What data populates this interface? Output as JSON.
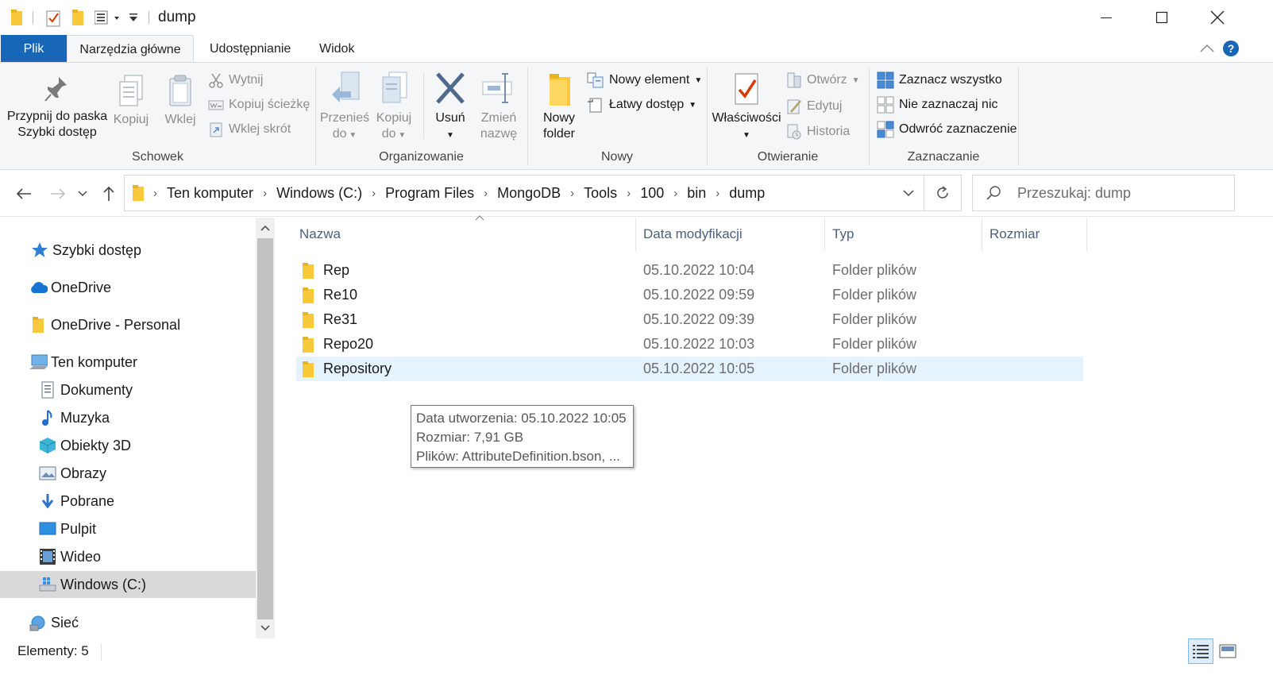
{
  "window": {
    "title": "dump"
  },
  "ribbon_tabs": [
    "Plik",
    "Narzędzia główne",
    "Udostępnianie",
    "Widok"
  ],
  "ribbon": {
    "clipboard": {
      "pin": "Przypnij do paska Szybki dostęp",
      "copy": "Kopiuj",
      "paste": "Wklej",
      "cut": "Wytnij",
      "copy_path": "Kopiuj ścieżkę",
      "paste_shortcut": "Wklej skrót",
      "label": "Schowek"
    },
    "organize": {
      "move_to": "Przenieś do",
      "copy_to": "Kopiuj do",
      "delete": "Usuń",
      "rename": "Zmień nazwę",
      "label": "Organizowanie"
    },
    "new": {
      "new_folder": "Nowy folder",
      "new_item": "Nowy element",
      "easy_access": "Łatwy dostęp",
      "label": "Nowy"
    },
    "open": {
      "properties": "Właściwości",
      "open": "Otwórz",
      "edit": "Edytuj",
      "history": "Historia",
      "label": "Otwieranie"
    },
    "select": {
      "select_all": "Zaznacz wszystko",
      "select_none": "Nie zaznaczaj nic",
      "invert": "Odwróć zaznaczenie",
      "label": "Zaznaczanie"
    }
  },
  "address": {
    "breadcrumbs": [
      "Ten komputer",
      "Windows (C:)",
      "Program Files",
      "MongoDB",
      "Tools",
      "100",
      "bin",
      "dump"
    ],
    "search_placeholder": "Przeszukaj: dump"
  },
  "nav_pane": [
    {
      "label": "Szybki dostęp",
      "icon": "star-icon"
    },
    {
      "label": "OneDrive",
      "icon": "cloud-icon"
    },
    {
      "label": "OneDrive - Personal",
      "icon": "folder-icon"
    },
    {
      "label": "Ten komputer",
      "icon": "computer-icon"
    },
    {
      "label": "Dokumenty",
      "icon": "document-icon"
    },
    {
      "label": "Muzyka",
      "icon": "music-icon"
    },
    {
      "label": "Obiekty 3D",
      "icon": "cube-icon"
    },
    {
      "label": "Obrazy",
      "icon": "picture-icon"
    },
    {
      "label": "Pobrane",
      "icon": "download-icon"
    },
    {
      "label": "Pulpit",
      "icon": "desktop-icon"
    },
    {
      "label": "Wideo",
      "icon": "video-icon"
    },
    {
      "label": "Windows (C:)",
      "icon": "drive-icon"
    },
    {
      "label": "Sieć",
      "icon": "network-icon"
    }
  ],
  "columns": [
    "Nazwa",
    "Data modyfikacji",
    "Typ",
    "Rozmiar"
  ],
  "files": [
    {
      "name": "Rep",
      "date": "05.10.2022 10:04",
      "type": "Folder plików"
    },
    {
      "name": "Re10",
      "date": "05.10.2022 09:59",
      "type": "Folder plików"
    },
    {
      "name": "Re31",
      "date": "05.10.2022 09:39",
      "type": "Folder plików"
    },
    {
      "name": "Repo20",
      "date": "05.10.2022 10:03",
      "type": "Folder plików"
    },
    {
      "name": "Repository",
      "date": "05.10.2022 10:05",
      "type": "Folder plików"
    }
  ],
  "tooltip": {
    "line1": "Data utworzenia: 05.10.2022 10:05",
    "line2": "Rozmiar: 7,91 GB",
    "line3": "Plików: AttributeDefinition.bson, ..."
  },
  "status": {
    "items": "Elementy: 5"
  },
  "colors": {
    "accent": "#1766b8",
    "selection": "#e5f3ff",
    "folder": "#f8c93a"
  }
}
